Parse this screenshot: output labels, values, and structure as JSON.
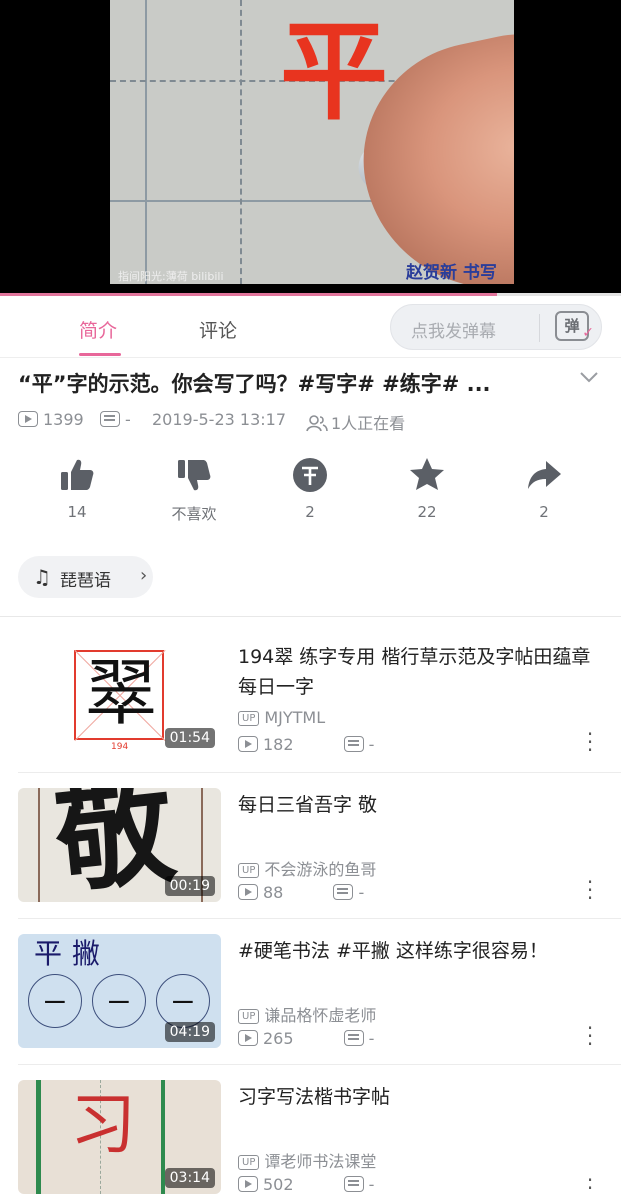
{
  "player": {
    "watermark_left": "指间阳光:薄荷 bilibili",
    "watermark_right": "赵贺新 书写",
    "frame_character": "平",
    "progress_fraction": 0.8
  },
  "tabs": [
    {
      "label": "简介",
      "active": true
    },
    {
      "label": "评论",
      "active": false
    }
  ],
  "danmaku": {
    "placeholder": "点我发弹幕",
    "button_label": "弹"
  },
  "video": {
    "title": "“平”字的示范。你会写了吗？#写字# #练字# ...",
    "views": "1399",
    "danmaku_count": "-",
    "date": "2019-5-23 13:17",
    "watching": "1人正在看"
  },
  "actions": [
    {
      "name": "like",
      "icon": "thumbs-up-icon",
      "label": "14"
    },
    {
      "name": "dislike",
      "icon": "thumbs-down-icon",
      "label": "不喜欢"
    },
    {
      "name": "coin",
      "icon": "coin-icon",
      "label": "2"
    },
    {
      "name": "favorite",
      "icon": "star-icon",
      "label": "22"
    },
    {
      "name": "share",
      "icon": "share-icon",
      "label": "2"
    }
  ],
  "music": {
    "label": "琵琶语"
  },
  "recommendations": [
    {
      "title": "194翠 练字专用 楷行草示范及字帖田蕴章每日一字",
      "up": "MJYTML",
      "views": "182",
      "danmaku": "-",
      "duration": "01:54",
      "thumb_char": "翠",
      "thumb_num": "194"
    },
    {
      "title": "每日三省吾字 敬",
      "up": "不会游泳的鱼哥",
      "views": "88",
      "danmaku": "-",
      "duration": "00:19",
      "thumb_char": "敬"
    },
    {
      "title": "#硬笔书法 #平撇 这样练字很容易！",
      "up": "谦品格怀虚老师",
      "views": "265",
      "danmaku": "-",
      "duration": "04:19",
      "thumb_header": "平撇",
      "thumb_stroke": "ㄧ"
    },
    {
      "title": "习字写法楷书字帖",
      "up": "谭老师书法课堂",
      "views": "502",
      "danmaku": "-",
      "duration": "03:14",
      "thumb_char": "习"
    }
  ],
  "up_badge": "UP",
  "colors": {
    "accent": "#e8679a",
    "meta_gray": "#8c8f94",
    "brush_red": "#e8341f"
  }
}
